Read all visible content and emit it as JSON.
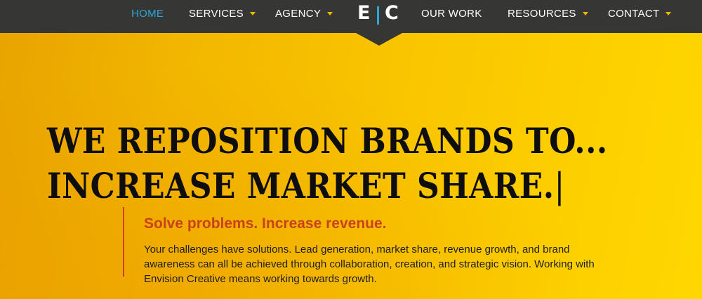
{
  "nav": {
    "items": [
      {
        "label": "HOME",
        "active": true,
        "has_dropdown": false
      },
      {
        "label": "SERVICES",
        "active": false,
        "has_dropdown": true
      },
      {
        "label": "AGENCY",
        "active": false,
        "has_dropdown": true
      },
      {
        "label": "OUR WORK",
        "active": false,
        "has_dropdown": false
      },
      {
        "label": "RESOURCES",
        "active": false,
        "has_dropdown": true
      },
      {
        "label": "CONTACT",
        "active": false,
        "has_dropdown": true
      }
    ],
    "logo": {
      "left": "E",
      "right": "C"
    }
  },
  "hero": {
    "headline": [
      "WE REPOSITION BRANDS TO...",
      "INCREASE MARKET SHARE."
    ],
    "cursor": "|",
    "subheading": "Solve problems. Increase revenue.",
    "body": "Your challenges have solutions. Lead generation, market share, revenue growth, and brand awareness can all be achieved through collaboration, creation, and strategic vision. Working with Envision Creative means working towards growth."
  },
  "colors": {
    "nav_background": "#363735",
    "nav_active": "#2ba6d9",
    "caret": "#f2b600",
    "hero_gradient_start": "#e8a300",
    "hero_gradient_end": "#ffd700",
    "accent_red": "#c9421c",
    "headline_text": "#0e0e0e"
  }
}
